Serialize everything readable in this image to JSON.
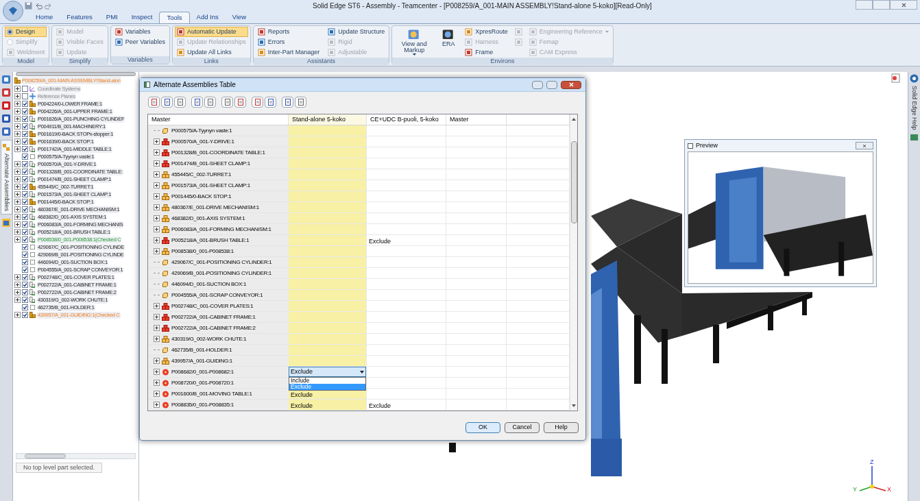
{
  "window": {
    "title": "Solid Edge ST6 - Assembly - Teamcenter - [P008259/A_001-MAIN ASSEMBLY!Stand-alone 5-koko][Read-Only]"
  },
  "ribbon": {
    "tabs": [
      {
        "label": "Home",
        "selected": false
      },
      {
        "label": "Features",
        "selected": false
      },
      {
        "label": "PMI",
        "selected": false
      },
      {
        "label": "Inspect",
        "selected": false
      },
      {
        "label": "Tools",
        "selected": true
      },
      {
        "label": "Add Ins",
        "selected": false
      },
      {
        "label": "View",
        "selected": false
      }
    ],
    "groups": [
      {
        "label": "Model",
        "columns": [
          [
            {
              "label": "Design",
              "kind": "radio",
              "on": true,
              "disabled": false,
              "dropdown": false
            },
            {
              "label": "Simplify",
              "kind": "radio",
              "on": false,
              "disabled": true,
              "dropdown": false
            },
            {
              "label": "Weldment",
              "kind": "small",
              "on": false,
              "disabled": true,
              "dropdown": false
            }
          ]
        ]
      },
      {
        "label": "Simplify",
        "columns": [
          [
            {
              "label": "Model",
              "kind": "small",
              "on": false,
              "disabled": true,
              "dropdown": false
            },
            {
              "label": "Visible Faces",
              "kind": "small",
              "on": false,
              "disabled": true,
              "dropdown": false
            },
            {
              "label": "Update",
              "kind": "small",
              "on": false,
              "disabled": true,
              "dropdown": false
            }
          ]
        ]
      },
      {
        "label": "Variables",
        "columns": [
          [
            {
              "label": "Variables",
              "kind": "small",
              "on": false,
              "disabled": false,
              "dropdown": false
            },
            {
              "label": "Peer Variables",
              "kind": "small",
              "on": false,
              "disabled": false,
              "dropdown": false
            }
          ]
        ]
      },
      {
        "label": "Links",
        "columns": [
          [
            {
              "label": "Automatic Update",
              "kind": "small",
              "on": true,
              "disabled": false,
              "dropdown": false
            },
            {
              "label": "Update Relationships",
              "kind": "small",
              "on": false,
              "disabled": true,
              "dropdown": false
            },
            {
              "label": "Update All Links",
              "kind": "small",
              "on": false,
              "disabled": false,
              "dropdown": false
            }
          ]
        ]
      },
      {
        "label": "Assistants",
        "columns": [
          [
            {
              "label": "Reports",
              "kind": "small",
              "on": false,
              "disabled": false,
              "dropdown": false
            },
            {
              "label": "Errors",
              "kind": "small",
              "on": false,
              "disabled": false,
              "dropdown": false
            },
            {
              "label": "Inter-Part Manager",
              "kind": "small",
              "on": false,
              "disabled": false,
              "dropdown": false
            }
          ],
          [
            {
              "label": "Update Structure",
              "kind": "small",
              "on": false,
              "disabled": false,
              "dropdown": false
            },
            {
              "label": "Rigid",
              "kind": "small",
              "on": false,
              "disabled": true,
              "dropdown": false
            },
            {
              "label": "Adjustable",
              "kind": "small",
              "on": false,
              "disabled": true,
              "dropdown": false
            }
          ]
        ]
      },
      {
        "label": "Environs",
        "columns": [
          [
            {
              "label": "View and Markup",
              "kind": "large",
              "on": false,
              "disabled": false,
              "dropdown": true
            }
          ],
          [
            {
              "label": "ERA",
              "kind": "large",
              "on": false,
              "disabled": false,
              "dropdown": false
            }
          ],
          [
            {
              "label": "XpresRoute",
              "kind": "small",
              "on": false,
              "disabled": false,
              "dropdown": false
            },
            {
              "label": "Harness",
              "kind": "small",
              "on": false,
              "disabled": true,
              "dropdown": false
            },
            {
              "label": "Frame",
              "kind": "small",
              "on": false,
              "disabled": false,
              "dropdown": false
            }
          ],
          [
            {
              "kind": "icon",
              "on": false,
              "disabled": true,
              "dropdown": false
            },
            {
              "kind": "icon",
              "on": false,
              "disabled": true,
              "dropdown": false
            }
          ],
          [
            {
              "label": "Engineering Reference",
              "kind": "small",
              "on": false,
              "disabled": true,
              "dropdown": true
            },
            {
              "label": "Femap",
              "kind": "small",
              "on": false,
              "disabled": true,
              "dropdown": false
            },
            {
              "label": "CAM Express",
              "kind": "small",
              "on": false,
              "disabled": true,
              "dropdown": false
            }
          ]
        ]
      }
    ]
  },
  "side_tabs": [
    {
      "label": "Alternate Assemblies",
      "selected": true
    }
  ],
  "tree": {
    "root": {
      "label": "P008259/A_001-MAIN ASSEMBLY!Stand-alon",
      "kind": "assembly-checked-out"
    },
    "items": [
      {
        "label": "Coordinate Systems",
        "kind": "coordinates",
        "expandable": true,
        "checked": false
      },
      {
        "label": "Reference Planes",
        "kind": "planes",
        "expandable": true,
        "checked": false
      },
      {
        "label": "P004224/0-LOWER FRAME:1",
        "kind": "assembly",
        "expandable": true,
        "checked": true
      },
      {
        "label": "P004226/A_001-UPPER FRAME:1",
        "kind": "assembly",
        "expandable": true,
        "checked": true
      },
      {
        "label": "P001626/A_001-PUNCHING CYLINDEF",
        "kind": "subassembly",
        "expandable": true,
        "checked": true
      },
      {
        "label": "P004911/B_001-MACHINERY:1",
        "kind": "subassembly",
        "expandable": true,
        "checked": true
      },
      {
        "label": "P001619/0-BACK STOPx-stopper:1",
        "kind": "assembly",
        "expandable": true,
        "checked": true
      },
      {
        "label": "P001639/0-BACK STOP:1",
        "kind": "assembly",
        "expandable": true,
        "checked": true
      },
      {
        "label": "P001742/A_001-MIDDLE TABLE:1",
        "kind": "subassembly",
        "expandable": true,
        "checked": true
      },
      {
        "label": "P000575/A-Tyynyn vaste:1",
        "kind": "part",
        "expandable": false,
        "checked": true
      },
      {
        "label": "P000570/A_001-Y-DRIVE:1",
        "kind": "subassembly",
        "expandable": true,
        "checked": true
      },
      {
        "label": "P001328/B_001-COORDINATE TABLE:",
        "kind": "subassembly",
        "expandable": true,
        "checked": true
      },
      {
        "label": "P001474/B_001-SHEET CLAMP:1",
        "kind": "subassembly",
        "expandable": true,
        "checked": true
      },
      {
        "label": "455445/C_002-TURRET:1",
        "kind": "assembly",
        "expandable": true,
        "checked": true
      },
      {
        "label": "P001573/A_001-SHEET CLAMP:1",
        "kind": "subassembly",
        "expandable": true,
        "checked": true
      },
      {
        "label": "P001445/0-BACK STOP:1",
        "kind": "assembly",
        "expandable": true,
        "checked": true
      },
      {
        "label": "480367/E_001-DRIVE MECHANISM:1",
        "kind": "subassembly",
        "expandable": true,
        "checked": true
      },
      {
        "label": "468382/D_001-AXIS SYSTEM:1",
        "kind": "subassembly",
        "expandable": true,
        "checked": true
      },
      {
        "label": "P006083/A_001-FORMING MECHANIS",
        "kind": "subassembly",
        "expandable": true,
        "checked": true
      },
      {
        "label": "P005218/A_001-BRUSH TABLE:1",
        "kind": "subassembly",
        "expandable": true,
        "checked": true
      },
      {
        "label": "P008538/0_001-P008538:1(Checked C",
        "kind": "subassembly-checked-in",
        "expandable": true,
        "checked": true
      },
      {
        "label": "429067/C_001-POSITIONING CYLINDE",
        "kind": "part",
        "expandable": false,
        "checked": true
      },
      {
        "label": "429069/B_001-POSITIONING CYLINDE",
        "kind": "part",
        "expandable": false,
        "checked": true
      },
      {
        "label": "446094/D_001-SUCTION BOX:1",
        "kind": "part",
        "expandable": false,
        "checked": true
      },
      {
        "label": "P004555/A_001-SCRAP CONVEYOR:1",
        "kind": "part",
        "expandable": false,
        "checked": true
      },
      {
        "label": "P002748/C_001-COVER PLATES:1",
        "kind": "subassembly",
        "expandable": true,
        "checked": true
      },
      {
        "label": "P002722/A_001-CABINET FRAME:1",
        "kind": "subassembly",
        "expandable": true,
        "checked": true
      },
      {
        "label": "P002722/A_001-CABINET FRAME:2",
        "kind": "subassembly",
        "expandable": true,
        "checked": true
      },
      {
        "label": "430319/G_002-WORK CHUTE:1",
        "kind": "subassembly",
        "expandable": true,
        "checked": true
      },
      {
        "label": "462735/B_001-HOLDER:1",
        "kind": "part",
        "expandable": false,
        "checked": true
      },
      {
        "label": "439957/A_001-GUIDING:1(Checked C",
        "kind": "assembly-checked-out",
        "expandable": true,
        "checked": true
      }
    ]
  },
  "status_text": "No top level part selected.",
  "dialog": {
    "title": "Alternate Assemblies Table",
    "columns": [
      {
        "label": "Master",
        "selected": false
      },
      {
        "label": "Stand-alone 5-koko",
        "selected": true
      },
      {
        "label": "CE+UDC B-puoli, 5-koko",
        "selected": false
      },
      {
        "label": "Master",
        "selected": false
      }
    ],
    "rows": [
      {
        "kind": "part",
        "expandable": false,
        "cells": [
          "P000575/A-Tyynyn vaste:1",
          "",
          "",
          ""
        ]
      },
      {
        "kind": "modified",
        "expandable": true,
        "cells": [
          "P000570/A_001-Y-DRIVE:1",
          "",
          "",
          ""
        ]
      },
      {
        "kind": "modified",
        "expandable": true,
        "cells": [
          "P001328/B_001-COORDINATE TABLE:1",
          "",
          "",
          ""
        ]
      },
      {
        "kind": "modified",
        "expandable": true,
        "cells": [
          "P001474/B_001-SHEET CLAMP:1",
          "",
          "",
          ""
        ]
      },
      {
        "kind": "assembly",
        "expandable": true,
        "cells": [
          "455445/C_002-TURRET:1",
          "",
          "",
          ""
        ]
      },
      {
        "kind": "assembly",
        "expandable": true,
        "cells": [
          "P001573/A_001-SHEET CLAMP:1",
          "",
          "",
          ""
        ]
      },
      {
        "kind": "assembly",
        "expandable": true,
        "cells": [
          "P001445/0-BACK STOP:1",
          "",
          "",
          ""
        ]
      },
      {
        "kind": "assembly",
        "expandable": true,
        "cells": [
          "480367/E_001-DRIVE MECHANISM:1",
          "",
          "",
          ""
        ]
      },
      {
        "kind": "assembly",
        "expandable": true,
        "cells": [
          "468382/D_001-AXIS SYSTEM:1",
          "",
          "",
          ""
        ]
      },
      {
        "kind": "assembly",
        "expandable": true,
        "cells": [
          "P006083/A_001-FORMING MECHANISM:1",
          "",
          "",
          ""
        ]
      },
      {
        "kind": "modified",
        "expandable": true,
        "cells": [
          "P005218/A_001-BRUSH TABLE:1",
          "",
          "Exclude",
          ""
        ]
      },
      {
        "kind": "assembly",
        "expandable": true,
        "cells": [
          "P008538/0_001-P008538:1",
          "",
          "",
          ""
        ]
      },
      {
        "kind": "part",
        "expandable": false,
        "cells": [
          "429067/C_001-POSITIONING CYLINDER:1",
          "",
          "",
          ""
        ]
      },
      {
        "kind": "part",
        "expandable": false,
        "cells": [
          "429069/B_001-POSITIONING CYLINDER:1",
          "",
          "",
          ""
        ]
      },
      {
        "kind": "part",
        "expandable": false,
        "cells": [
          "446094/D_001-SUCTION BOX:1",
          "",
          "",
          ""
        ]
      },
      {
        "kind": "part",
        "expandable": false,
        "cells": [
          "P004555/A_001-SCRAP CONVEYOR:1",
          "",
          "",
          ""
        ]
      },
      {
        "kind": "modified",
        "expandable": true,
        "cells": [
          "P002748/C_001-COVER PLATES:1",
          "",
          "",
          ""
        ]
      },
      {
        "kind": "modified",
        "expandable": true,
        "cells": [
          "P002722/A_001-CABINET FRAME:1",
          "",
          "",
          ""
        ]
      },
      {
        "kind": "modified",
        "expandable": true,
        "cells": [
          "P002722/A_001-CABINET FRAME:2",
          "",
          "",
          ""
        ]
      },
      {
        "kind": "assembly",
        "expandable": true,
        "cells": [
          "430319/G_002-WORK CHUTE:1",
          "",
          "",
          ""
        ]
      },
      {
        "kind": "part",
        "expandable": false,
        "cells": [
          "462735/B_001-HOLDER:1",
          "",
          "",
          ""
        ]
      },
      {
        "kind": "assembly",
        "expandable": true,
        "cells": [
          "439957/A_001-GUIDING:1",
          "",
          "",
          ""
        ]
      },
      {
        "kind": "new",
        "expandable": true,
        "cells": [
          "P008682/0_001-P008682:1",
          "",
          "",
          ""
        ],
        "editor": {
          "value": "Exclude",
          "options": [
            {
              "label": "Include",
              "selected": false
            },
            {
              "label": "Exclude",
              "selected": true
            }
          ]
        }
      },
      {
        "kind": "new",
        "expandable": true,
        "cells": [
          "P008720/0_001-P008720:1",
          "",
          "",
          ""
        ]
      },
      {
        "kind": "new",
        "expandable": true,
        "cells": [
          "P001600/B_001-MOVING TABLE:1",
          "Exclude",
          "",
          ""
        ]
      },
      {
        "kind": "new",
        "expandable": true,
        "cells": [
          "P008835/0_001-P008835:1",
          "Exclude",
          "Exclude",
          ""
        ]
      }
    ],
    "buttons": [
      {
        "label": "OK",
        "default": true
      },
      {
        "label": "Cancel",
        "default": false
      },
      {
        "label": "Help",
        "default": false
      }
    ]
  },
  "preview": {
    "title": "Preview"
  },
  "help_panel": {
    "label": "Solid Edge Help"
  },
  "triad": {
    "z": "Z",
    "x": "X",
    "y": "Y"
  }
}
